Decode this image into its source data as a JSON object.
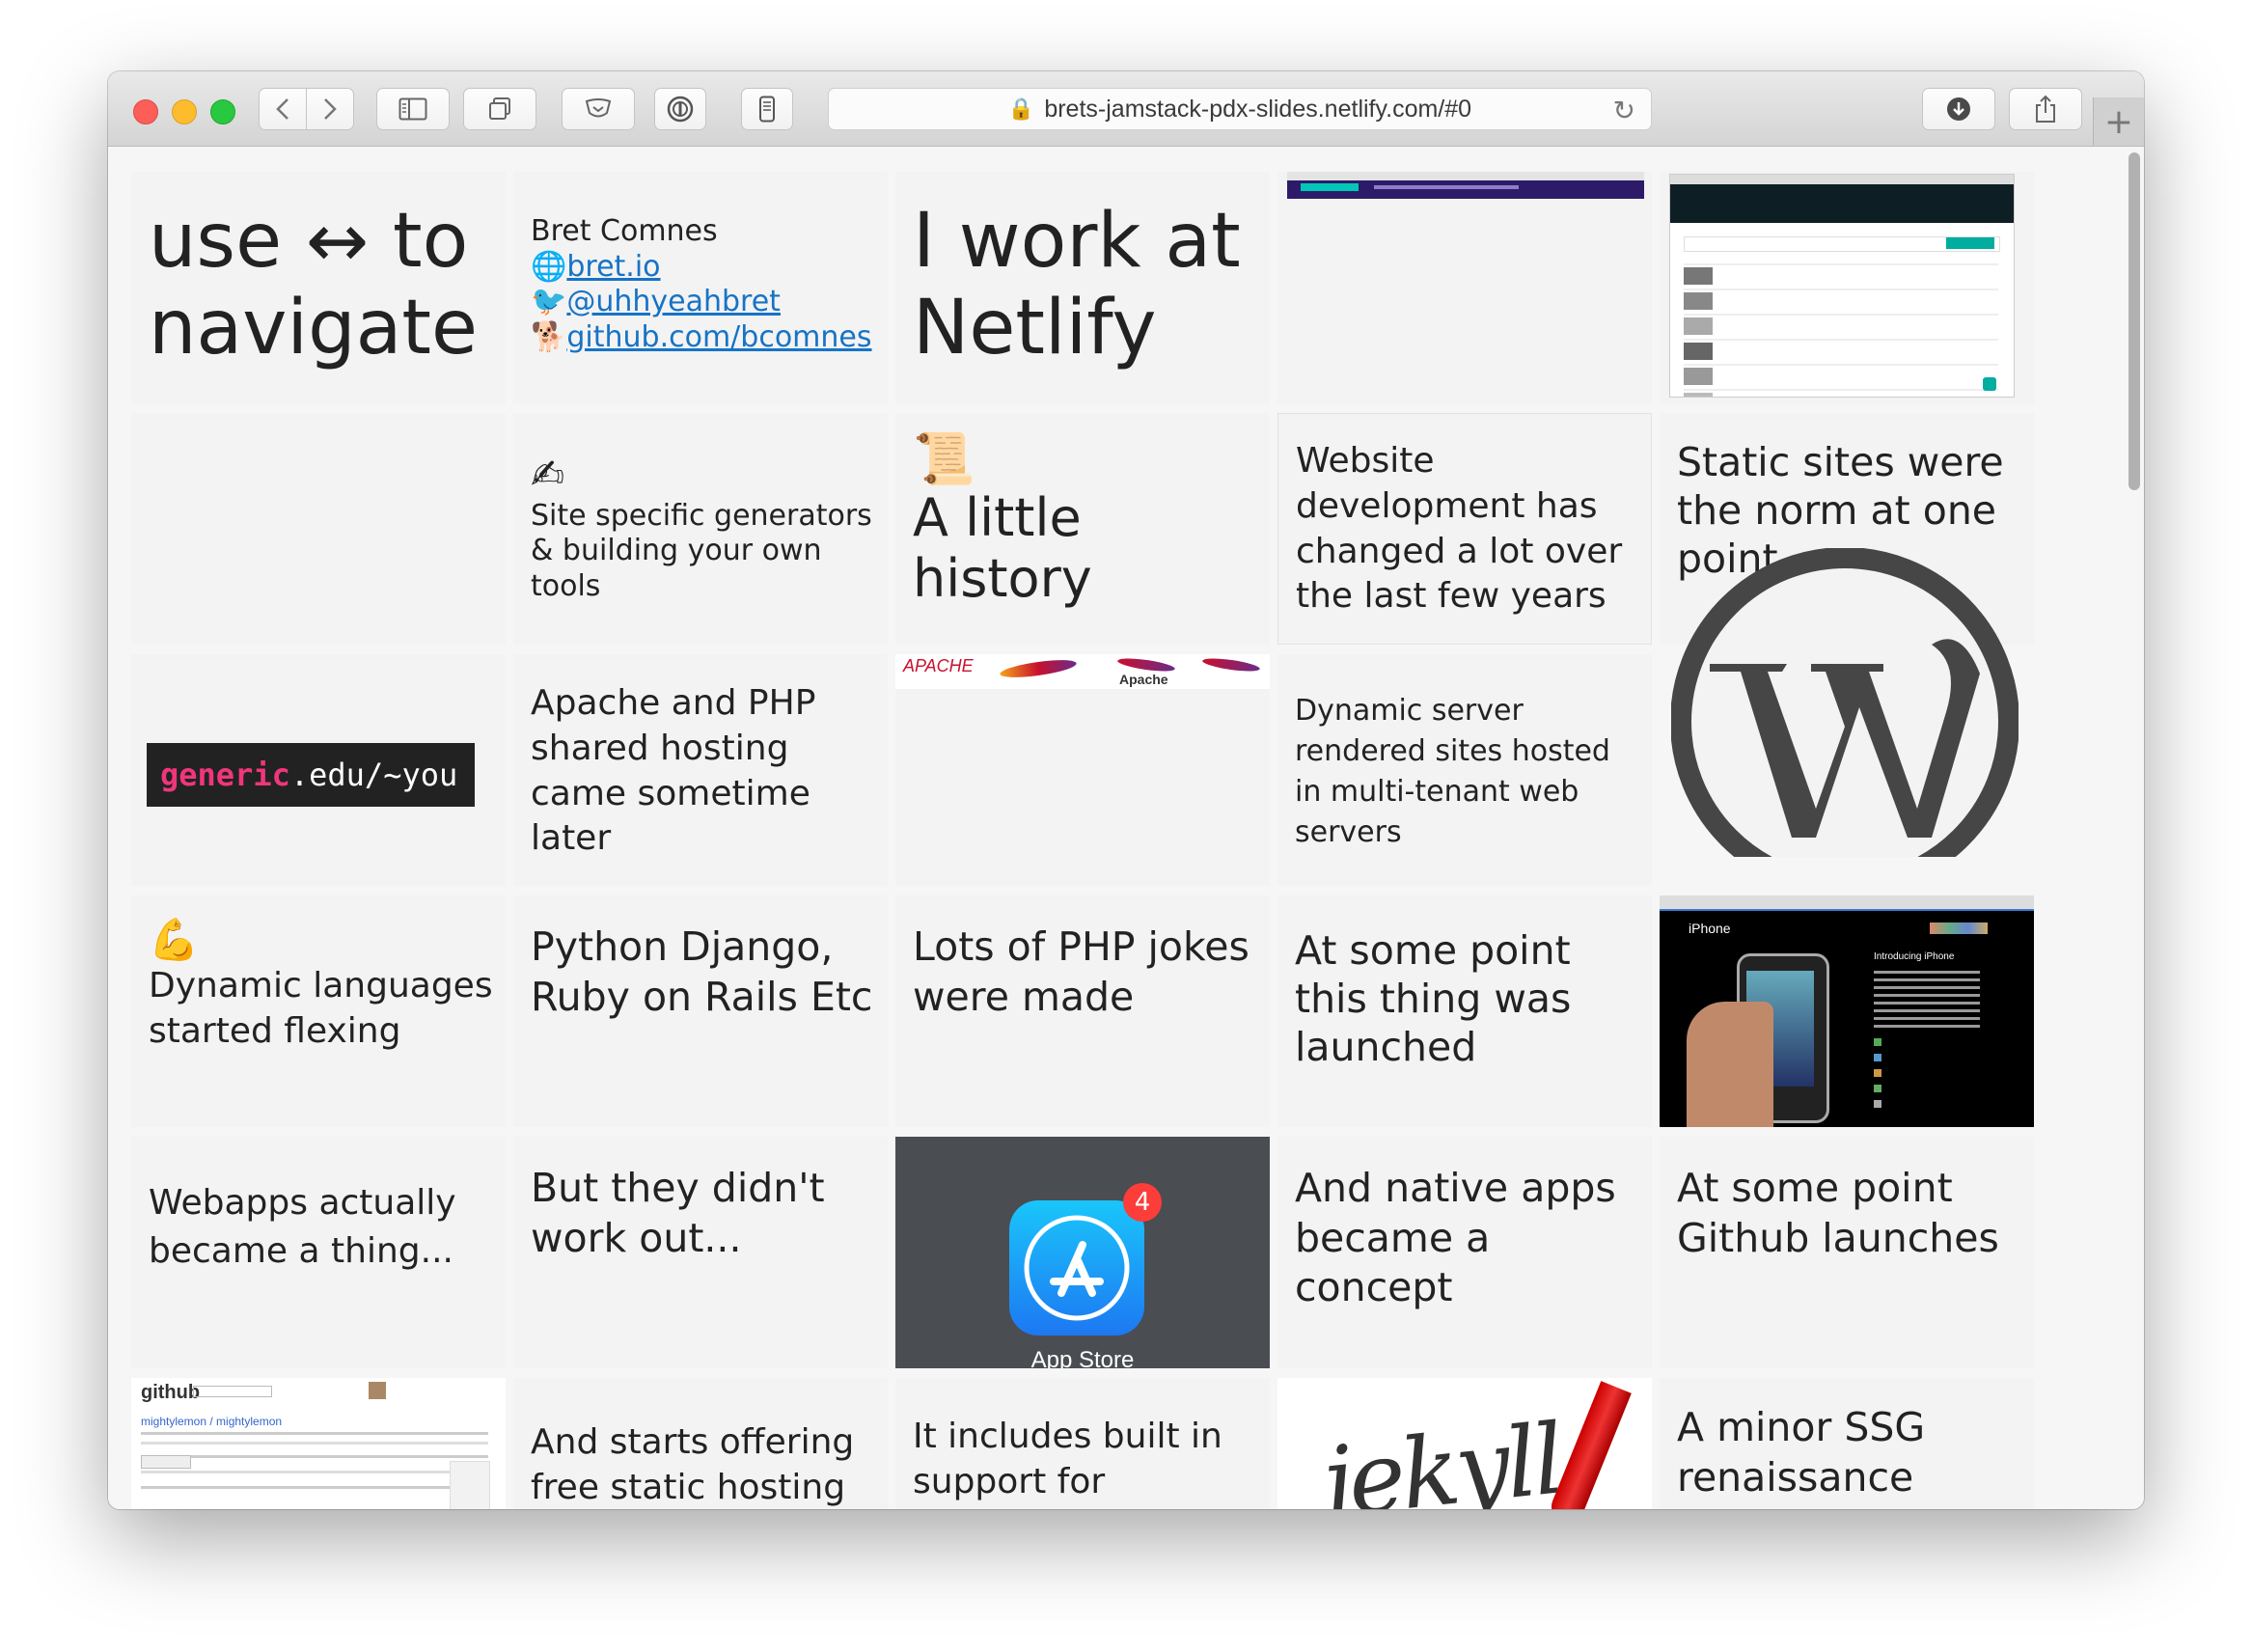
{
  "browser": {
    "url": "brets-jamstack-pdx-slides.netlify.com/#0",
    "new_tab_label": "+"
  },
  "slides": {
    "s1": "use ↔ to navigate",
    "s2": {
      "name": "Bret Comnes",
      "site": "bret.io",
      "twitter": "@uhhyeahbret",
      "github": "github.com/bcomnes"
    },
    "s3": "I work at Netlify",
    "s7": {
      "emoji": "✍",
      "text": "Site specific generators & building your own tools"
    },
    "s8": {
      "emoji": "📜",
      "text": "A little history"
    },
    "s9": "Website development has changed a lot over the last few years",
    "s10": "Static sites were the norm at one point",
    "s11": {
      "part1": "generic",
      "part2": ".edu/~you"
    },
    "s12": "Apache and PHP shared hosting came sometime later",
    "s13": {
      "apache": "APACHE",
      "apache2": "Apache"
    },
    "s14": "Dynamic server rendered sites hosted in multi-tenant web servers",
    "s16": {
      "emoji": "💪",
      "text": "Dynamic languages started flexing"
    },
    "s17": "Python Django, Ruby on Rails Etc",
    "s18": "Lots of PHP jokes were made",
    "s19": "At some point this thing was launched",
    "s20": {
      "brand": "iPhone",
      "heading": "Introducing iPhone"
    },
    "s21": "Webapps actually became a thing...",
    "s22": "But they didn't work out...",
    "s23": {
      "label": "App Store",
      "badge": "4"
    },
    "s24": "And native apps became a concept",
    "s25": "At some point Github launches",
    "s26": {
      "logo": "github",
      "repo": "mightylemon / mightylemon"
    },
    "s27": "And starts offering free static hosting",
    "s28": "It includes built in support for",
    "s29": "jekyll",
    "s30": "A minor SSG renaissance"
  }
}
